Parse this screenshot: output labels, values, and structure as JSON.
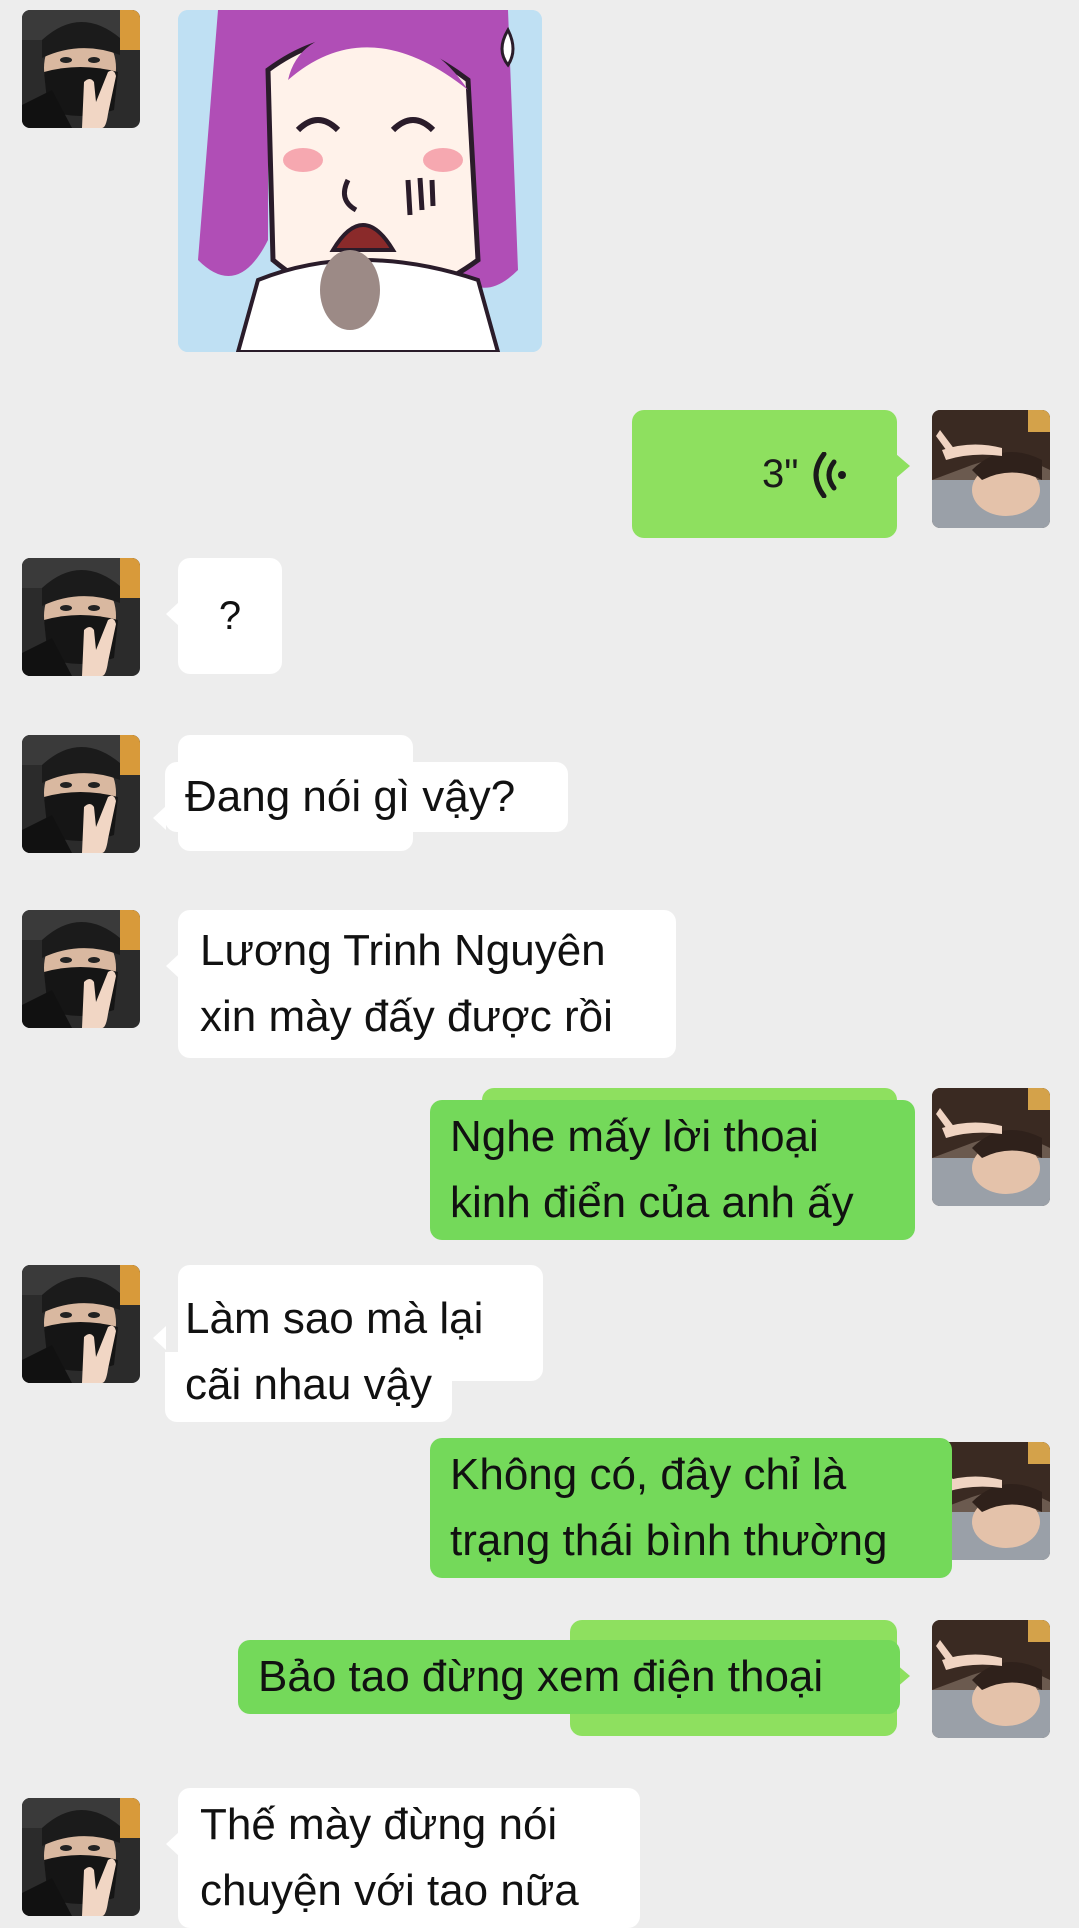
{
  "chat": {
    "contact_avatar_icon": "masked-person-avatar",
    "self_avatar_icon": "peace-sign-person-avatar",
    "colors": {
      "background": "#ededed",
      "incoming_bubble": "#ffffff",
      "outgoing_bubble": "#74d95a",
      "outgoing_bubble_light": "#8ee05f"
    },
    "messages": [
      {
        "id": "m1",
        "from": "contact",
        "type": "sticker",
        "icon": "purple-hair-girl-sticker"
      },
      {
        "id": "m2",
        "from": "self",
        "type": "voice",
        "duration": "3\"",
        "icon": "voice-wave-icon"
      },
      {
        "id": "m3",
        "from": "contact",
        "type": "text",
        "lines": [
          "?"
        ]
      },
      {
        "id": "m4",
        "from": "contact",
        "type": "text",
        "lines": [
          "Đang nói gì vậy?"
        ]
      },
      {
        "id": "m5",
        "from": "contact",
        "type": "text",
        "lines": [
          "Lương Trinh Nguyên",
          "xin mày đấy được rồi"
        ]
      },
      {
        "id": "m6",
        "from": "self",
        "type": "text",
        "lines": [
          "Nghe mấy lời thoại",
          "kinh điển của anh ấy"
        ]
      },
      {
        "id": "m7",
        "from": "contact",
        "type": "text",
        "lines": [
          "Làm sao mà lại",
          "cãi nhau vậy"
        ]
      },
      {
        "id": "m8",
        "from": "self",
        "type": "text",
        "lines": [
          "Không có, đây chỉ là",
          "trạng thái bình thường"
        ]
      },
      {
        "id": "m9",
        "from": "self",
        "type": "text",
        "lines": [
          "Bảo tao đừng xem điện thoại"
        ]
      },
      {
        "id": "m10",
        "from": "contact",
        "type": "text",
        "lines": [
          "Thế mày đừng nói",
          "chuyện với tao nữa"
        ]
      }
    ]
  }
}
